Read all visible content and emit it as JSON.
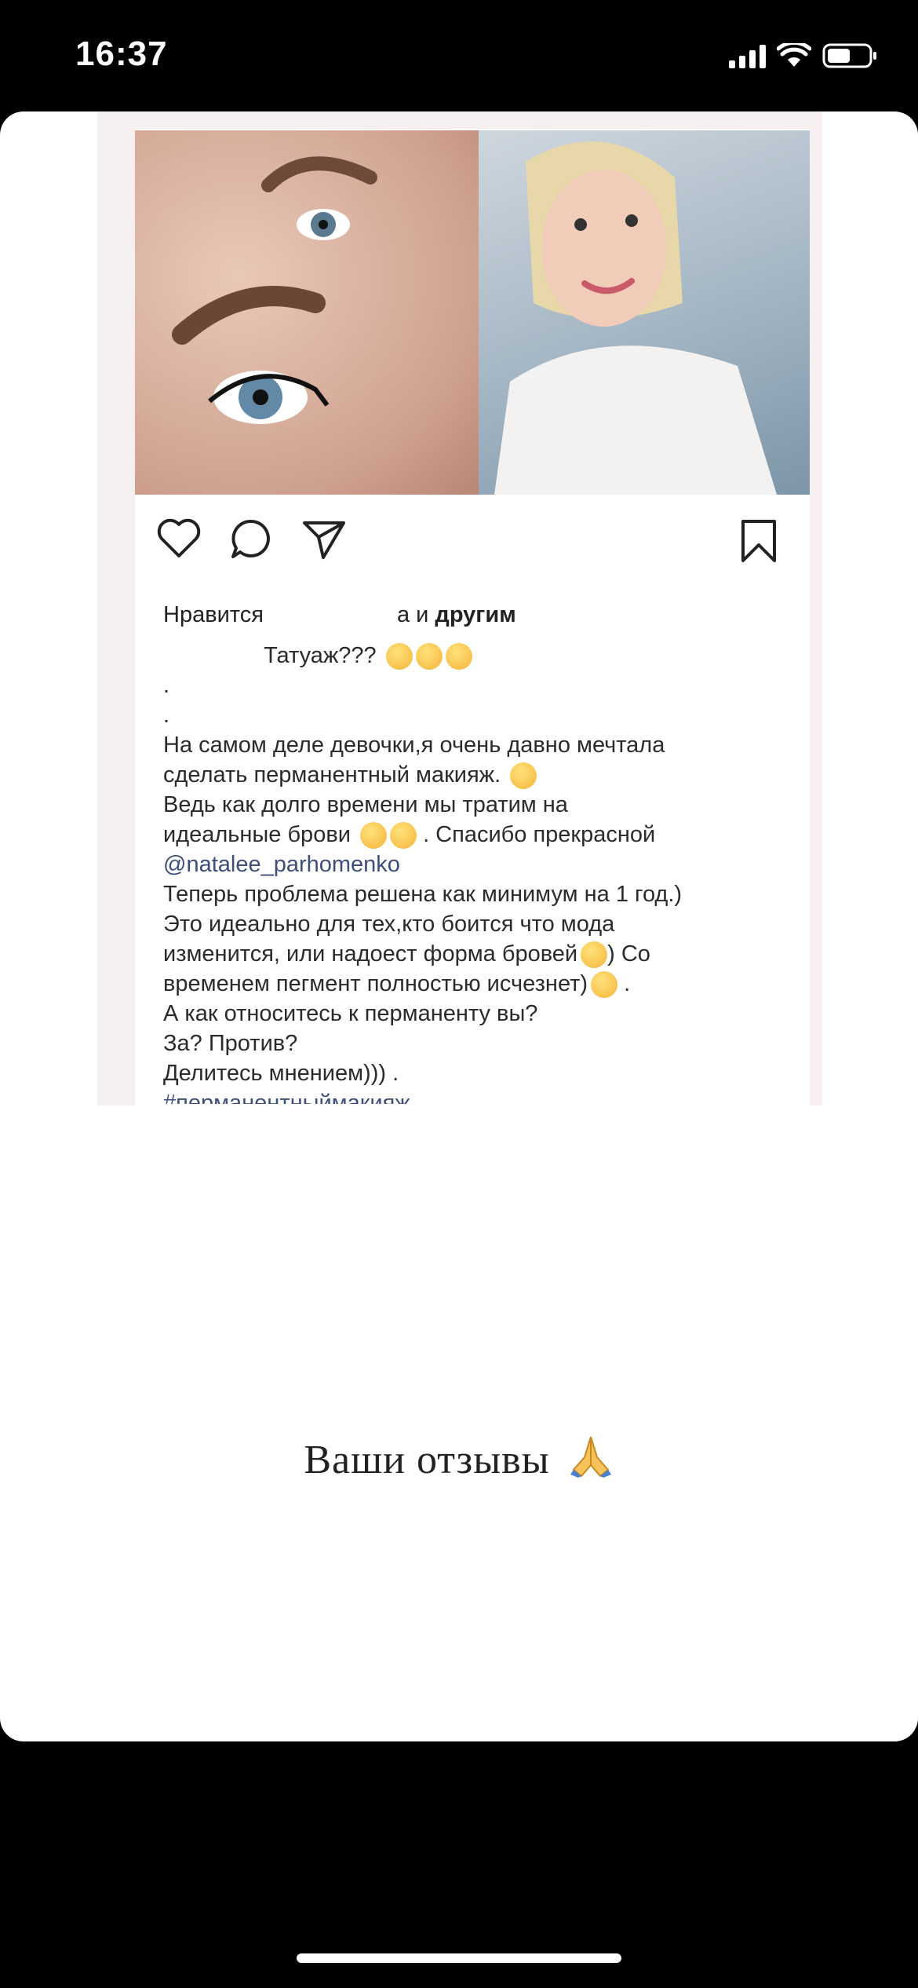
{
  "status_bar": {
    "time": "16:37"
  },
  "post": {
    "likes_prefix": "Нравится",
    "likes_suffix_plain": "а и ",
    "likes_suffix_bold": "другим",
    "caption_title": "Татуаж???",
    "caption_lines": [
      ".",
      ".",
      "На самом деле девочки,я очень давно мечтала",
      "сделать перманентный макияж.",
      " Ведь как долго времени мы тратим на",
      "идеальные брови",
      ". Спасибо прекрасной",
      "@natalee_parhomenko",
      "Теперь проблема решена как минимум на 1 год.)",
      "Это идеально для тех,кто боится что мода",
      "изменится, или надоест форма бровей",
      ") Со",
      "временем пегмент полностью исчезнет)",
      ".",
      "А как относитесь к перманенту вы?",
      "За? Против?",
      "Делитесь мнением))) .",
      "#перманентныймакияж"
    ]
  },
  "story_text": "Ваши отзывы",
  "icons": {
    "like": "heart-icon",
    "comment": "comment-icon",
    "share": "send-icon",
    "save": "bookmark-icon",
    "pray": "folded-hands-icon"
  }
}
